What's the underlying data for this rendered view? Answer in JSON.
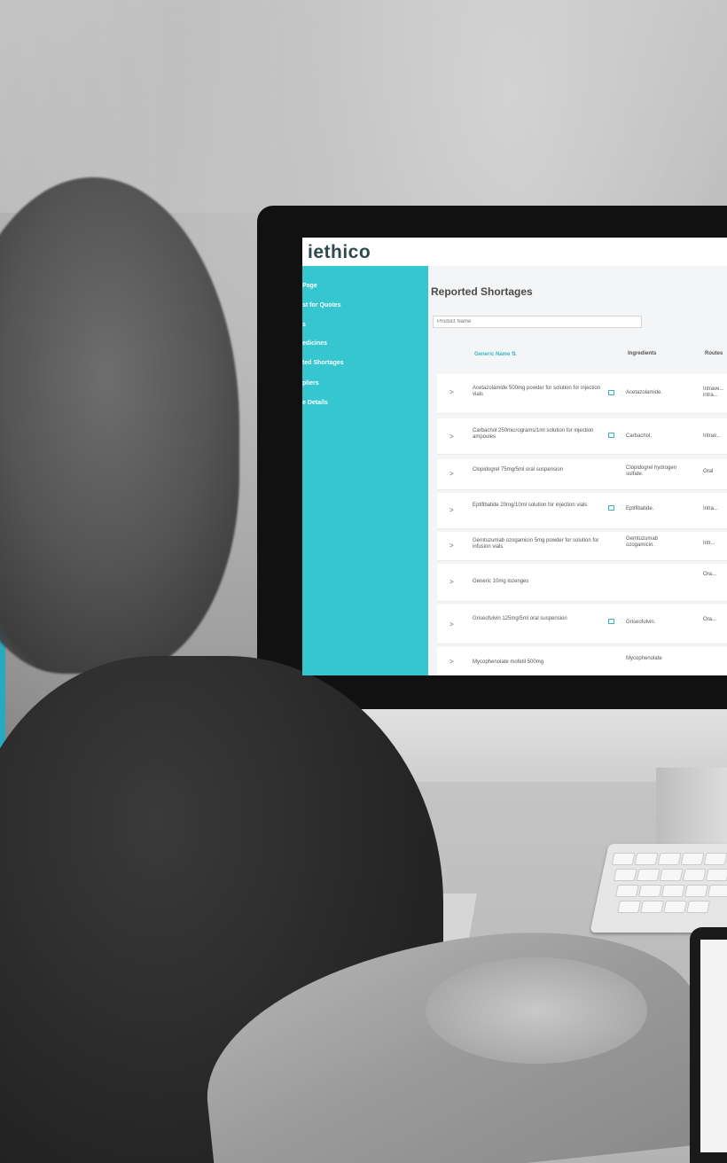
{
  "app": {
    "logo": "iethico"
  },
  "sidebar": {
    "items": [
      {
        "label": "Page"
      },
      {
        "label": "st for Quotes"
      },
      {
        "label": "s"
      },
      {
        "label": "edicines"
      },
      {
        "label": "ted Shortages"
      },
      {
        "label": "pliers"
      },
      {
        "label": "e Details"
      }
    ]
  },
  "main": {
    "title": "Reported Shortages",
    "search_placeholder": "Product Name",
    "columns": {
      "generic_name": "Generic Name ⇅",
      "ingredients": "Ingredients",
      "route": "Routes"
    },
    "rows": [
      {
        "chevron": ">",
        "name": "Acetazolamide 500mg powder for solution for injection vials",
        "has_doc": true,
        "ingredients": "Acetazolamide.",
        "route": "Intrave... intra..."
      },
      {
        "chevron": ">",
        "name": "Carbachol 250micrograms/1ml solution for injection ampoules",
        "has_doc": true,
        "ingredients": "Carbachol.",
        "route": "Intrav..."
      },
      {
        "chevron": ">",
        "name": "Clopidogrel 75mg/5ml oral suspension",
        "has_doc": false,
        "ingredients": "Clopidogrel hydrogen sulfate.",
        "route": "Oral"
      },
      {
        "chevron": ">",
        "name": "Eptifibatide 20mg/10ml solution for injection vials",
        "has_doc": true,
        "ingredients": "Eptifibatide.",
        "route": "Intra..."
      },
      {
        "chevron": ">",
        "name": "Gemtuzumab ozogamicin 5mg powder for solution for infusion vials",
        "has_doc": false,
        "ingredients": "Gemtuzumab ozogamicin.",
        "route": "Intr..."
      },
      {
        "chevron": ">",
        "name": "Generic 10mg lozenges",
        "has_doc": false,
        "ingredients": "",
        "route": "Ora..."
      },
      {
        "chevron": ">",
        "name": "Griseofulvin 125mg/5ml oral suspension",
        "has_doc": true,
        "ingredients": "Griseofulvin.",
        "route": "Ora..."
      },
      {
        "chevron": ">",
        "name": "Mycophenolate mofetil 500mg",
        "has_doc": false,
        "ingredients": "Mycophenolate",
        "route": ""
      }
    ]
  },
  "colors": {
    "sidebar": "#35c6d0",
    "accent": "#39b6c5",
    "logo_text": "#2f4a4c"
  }
}
